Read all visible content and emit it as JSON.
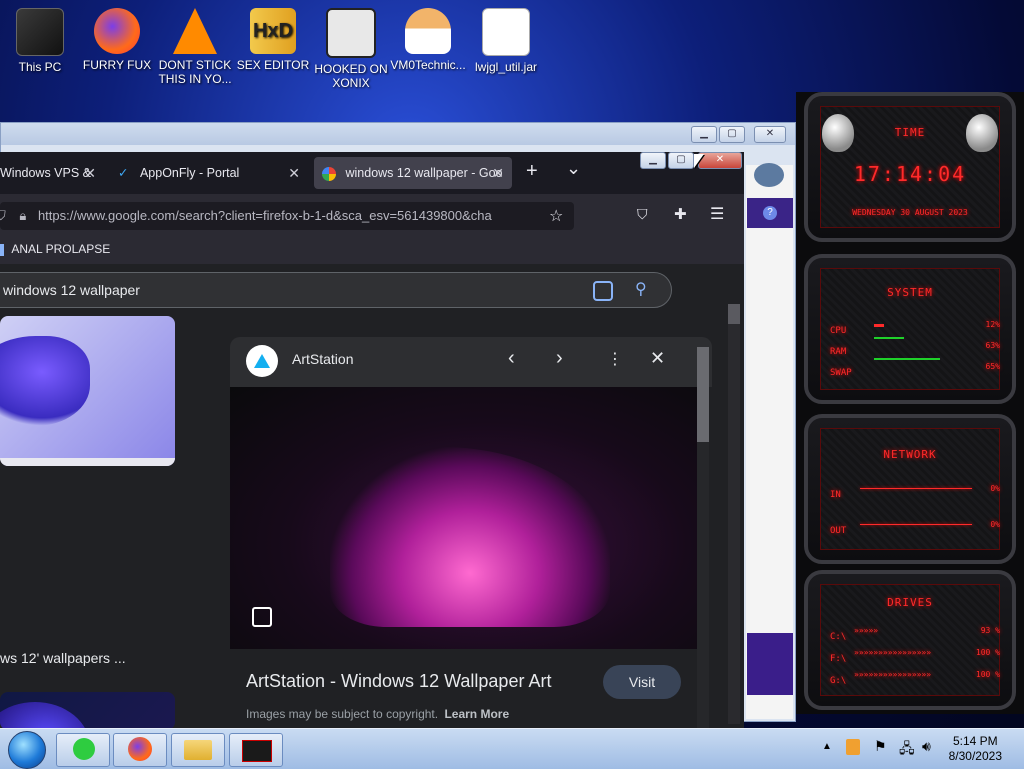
{
  "desktop": {
    "icons": [
      {
        "label": "This PC"
      },
      {
        "label": "FURRY FUX"
      },
      {
        "label": "DONT STICK THIS IN YO..."
      },
      {
        "label": "SEX EDITOR"
      },
      {
        "label": "HOOKED ON XONIX"
      },
      {
        "label": "VM0Technic..."
      },
      {
        "label": "lwjgl_util.jar"
      }
    ]
  },
  "firefox": {
    "tabs": [
      {
        "label": "Windows VPS &",
        "close": "✕"
      },
      {
        "label": "AppOnFly - Portal",
        "close": "✕"
      },
      {
        "label": "windows 12 wallpaper - Goo",
        "close": "✕"
      }
    ],
    "new_tab": "+",
    "tab_list": "⌄",
    "window_controls": {
      "minimize": "▁",
      "maximize": "▢",
      "close": "✕"
    },
    "url": "https://www.google.com/search?client=firefox-b-1-d&sca_esv=561439800&cha",
    "bookmark": "ANAL PROLAPSE",
    "search_query": "windows 12 wallpaper",
    "result_caption": "ws 12' wallpapers ...",
    "preview": {
      "source": "ArtStation",
      "title": "ArtStation - Windows 12 Wallpaper Art",
      "visit": "Visit",
      "copyright": "Images may be subject to copyright.",
      "learn_more": "Learn More"
    }
  },
  "widgets": {
    "time_title": "TIME",
    "time": "17:14:04",
    "date": "WEDNESDAY 30 AUGUST 2023",
    "system_title": "SYSTEM",
    "system": [
      {
        "label": "CPU",
        "value": "12%"
      },
      {
        "label": "RAM",
        "value": "63%"
      },
      {
        "label": "SWAP",
        "value": "65%"
      }
    ],
    "network_title": "NETWORK",
    "network": [
      {
        "label": "IN",
        "value": "0%"
      },
      {
        "label": "OUT",
        "value": "0%"
      }
    ],
    "drives_title": "DRIVES",
    "drives": [
      {
        "label": "C:\\",
        "value": "93 %"
      },
      {
        "label": "F:\\",
        "value": "100 %"
      },
      {
        "label": "G:\\",
        "value": "100 %"
      }
    ]
  },
  "taskbar": {
    "time": "5:14 PM",
    "date": "8/30/2023"
  }
}
